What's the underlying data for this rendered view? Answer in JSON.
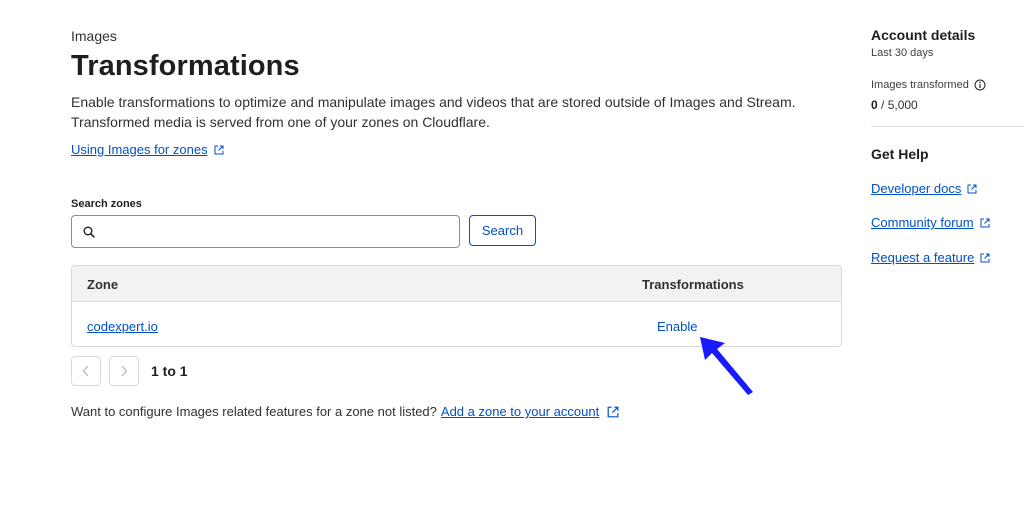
{
  "header": {
    "eyebrow": "Images",
    "title": "Transformations",
    "description": "Enable transformations to optimize and manipulate images and videos that are stored outside of Images and Stream. Transformed media is served from one of your zones on Cloudflare.",
    "doc_link": "Using Images for zones"
  },
  "search": {
    "label": "Search zones",
    "value": "",
    "placeholder": "",
    "button_label": "Search"
  },
  "table": {
    "columns": [
      "Zone",
      "Transformations"
    ],
    "rows": [
      {
        "zone": "codexpert.io",
        "action": "Enable"
      }
    ]
  },
  "pagination": {
    "range_text": "1 to 1"
  },
  "footer": {
    "text": "Want to configure Images related features for a zone not listed?",
    "link": "Add a zone to your account"
  },
  "sidebar": {
    "account_title": "Account details",
    "account_sub": "Last 30 days",
    "metric_label": "Images transformed",
    "metric_used": "0",
    "metric_total": " / 5,000",
    "help_title": "Get Help",
    "links": [
      "Developer docs",
      "Community forum",
      "Request a feature"
    ]
  },
  "colors": {
    "link": "#0051c3",
    "annotation_arrow": "#1a1aff"
  },
  "icons": [
    "external-link-icon",
    "search-icon",
    "chevron-left-icon",
    "chevron-right-icon",
    "info-icon",
    "annotation-arrow-icon"
  ]
}
